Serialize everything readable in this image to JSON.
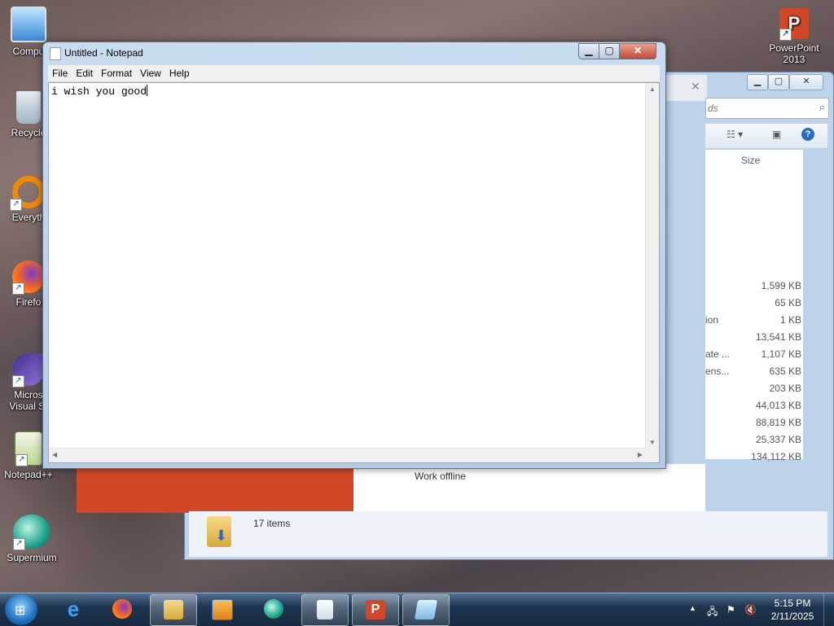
{
  "desktop": {
    "icons_left": [
      {
        "label": "Compu",
        "icon": "computer-icon"
      },
      {
        "label": "Recycle",
        "icon": "recycle-bin-icon"
      },
      {
        "label": "Everyth",
        "icon": "everything-search-icon"
      },
      {
        "label": "Firefo",
        "icon": "firefox-icon"
      },
      {
        "label": "Micros\nVisual St",
        "icon": "visual-studio-icon"
      },
      {
        "label": "Notepad++",
        "icon": "notepadpp-icon"
      },
      {
        "label": "Supermium",
        "icon": "supermium-icon"
      }
    ],
    "icons_right": [
      {
        "label": "PowerPoint\n2013",
        "icon": "powerpoint-icon"
      }
    ]
  },
  "notepad": {
    "title": "Untitled - Notepad",
    "menu": [
      "File",
      "Edit",
      "Format",
      "View",
      "Help"
    ],
    "content": "i wish you good",
    "controls": {
      "minimize": "▁",
      "maximize": "▢",
      "close": "✕"
    }
  },
  "explorer": {
    "search_placeholder": "ds",
    "column_size": "Size",
    "rows": [
      {
        "type": "",
        "size": "1,599 KB"
      },
      {
        "type": "",
        "size": "65 KB"
      },
      {
        "type": "ion",
        "size": "1 KB"
      },
      {
        "type": "",
        "size": "13,541 KB"
      },
      {
        "type": "ate ...",
        "size": "1,107 KB"
      },
      {
        "type": "ens...",
        "size": "635 KB"
      },
      {
        "type": "",
        "size": "203 KB"
      },
      {
        "type": "",
        "size": "44,013 KB"
      },
      {
        "type": "",
        "size": "88,819 KB"
      },
      {
        "type": "",
        "size": "25,337 KB"
      },
      {
        "type": "",
        "size": "134,112 KB"
      }
    ],
    "work_offline": "Work offline",
    "status_items": "17 items"
  },
  "taskbar": {
    "apps": [
      {
        "name": "internet-explorer-icon",
        "active": false
      },
      {
        "name": "firefox-icon",
        "active": false
      },
      {
        "name": "file-explorer-icon",
        "active": true
      },
      {
        "name": "media-player-icon",
        "active": false
      },
      {
        "name": "supermium-icon",
        "active": false
      },
      {
        "name": "document-icon",
        "active": true
      },
      {
        "name": "powerpoint-icon",
        "active": true
      },
      {
        "name": "notepad-icon",
        "active": true
      }
    ],
    "clock_time": "5:15 PM",
    "clock_date": "2/11/2025"
  },
  "colors": {
    "powerpoint_orange": "#d24726",
    "taskbar": "#1f3550",
    "window_frame": "#b4cbe3"
  }
}
